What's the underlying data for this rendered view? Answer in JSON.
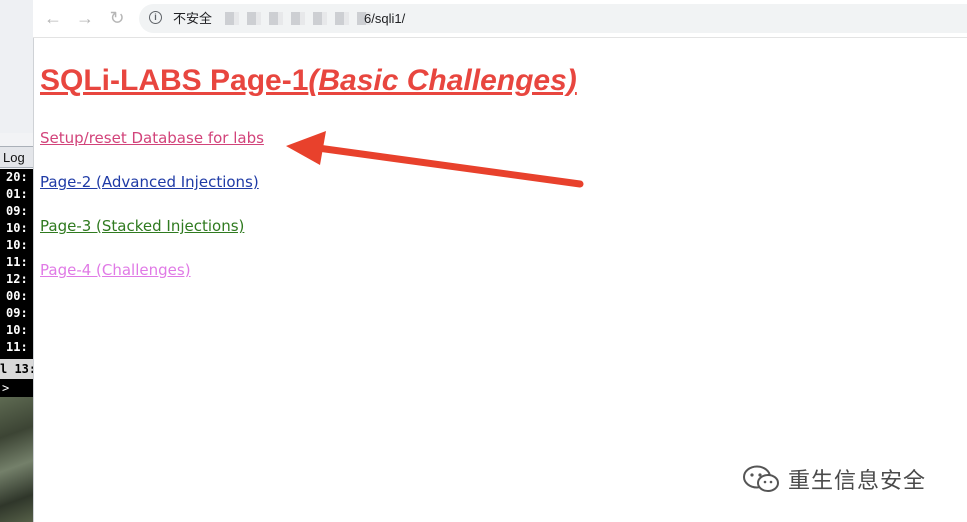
{
  "left_window": {
    "log_label": "Log",
    "terminal_lines": [
      "20:",
      "01:",
      "09:",
      "10:",
      "10:",
      "11:",
      "12:",
      "00:",
      "09:",
      "10:",
      "11:"
    ],
    "status_line": "l 13:",
    "prompt": ">"
  },
  "browser": {
    "security_label": "不安全",
    "url_suffix": "6/sqli1/"
  },
  "page": {
    "title_main": "SQLi-LABS Page-1",
    "title_sub": "(Basic Challenges)",
    "links": {
      "setup": "Setup/reset Database for labs",
      "page2": "Page-2 (Advanced Injections)",
      "page3": "Page-3 (Stacked Injections)",
      "page4": "Page-4 (Challenges)"
    }
  },
  "annotation": {
    "arrow_color": "#e8412c"
  },
  "watermark": {
    "text": "重生信息安全"
  }
}
